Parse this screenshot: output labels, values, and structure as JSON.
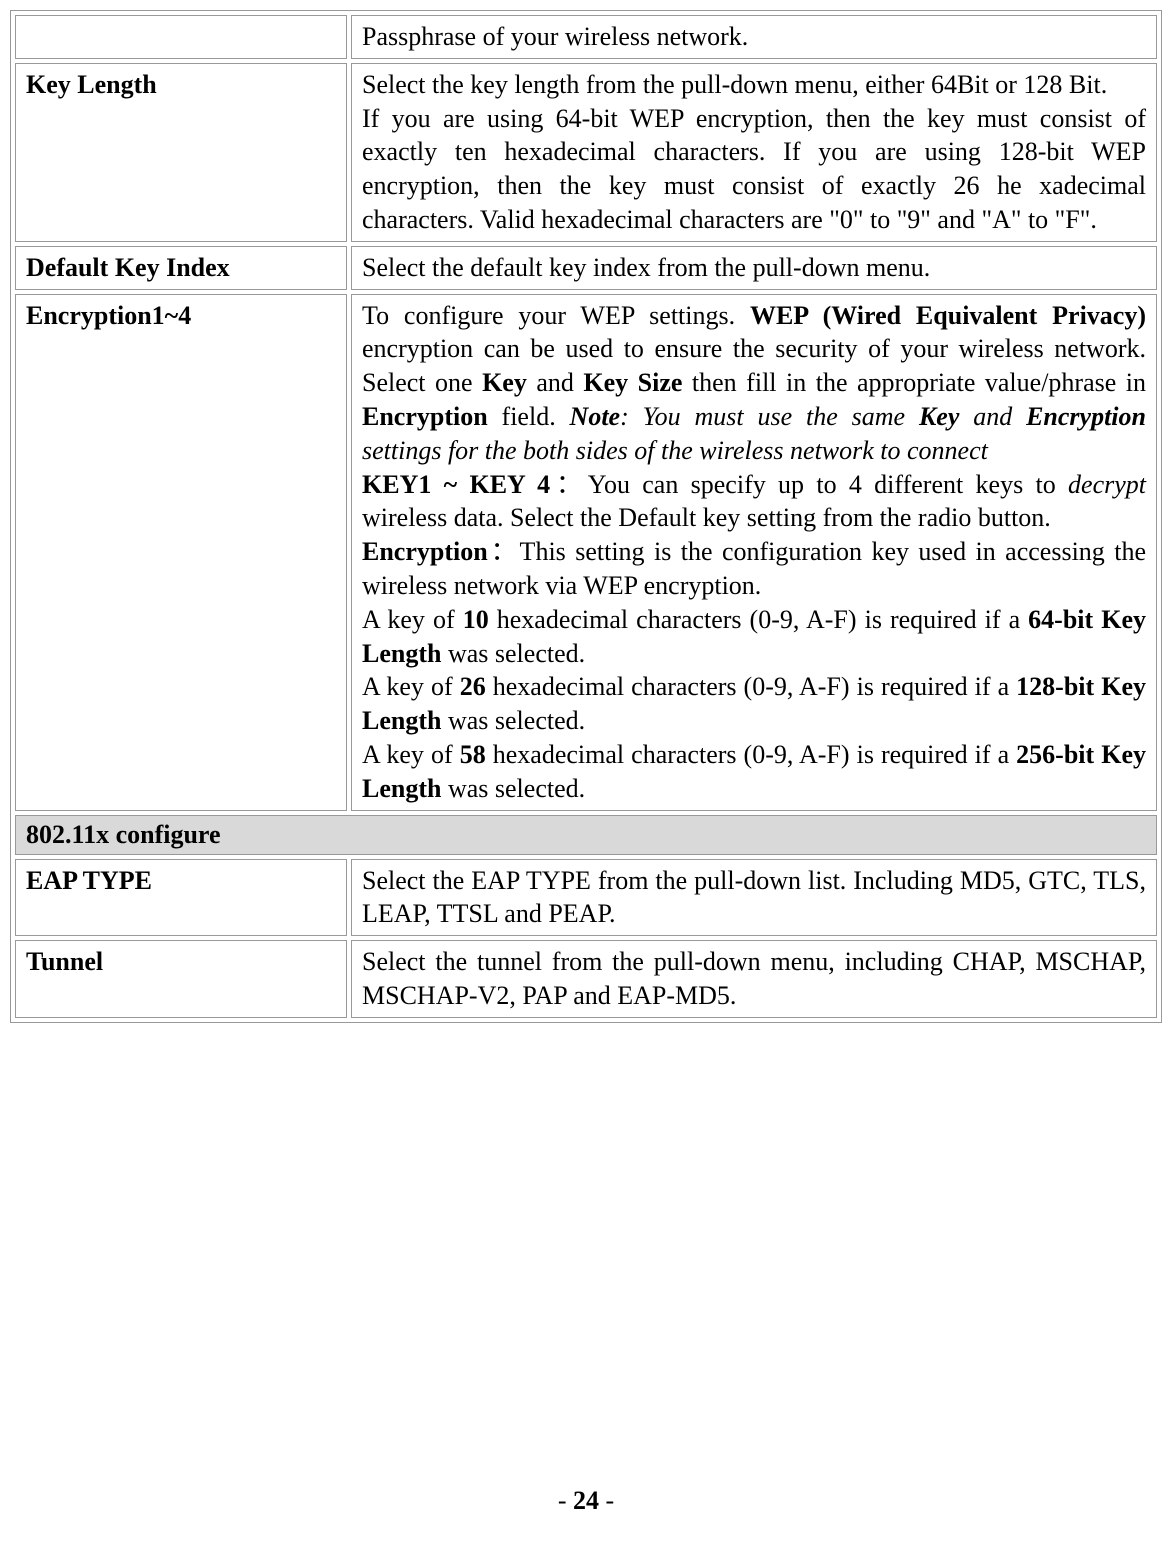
{
  "row_passphrase": {
    "label": "",
    "desc": "Passphrase of your wireless network."
  },
  "row_keylength": {
    "label": "Key Length",
    "desc": "Select the key length from the pull-down menu, either 64Bit or 128 Bit.\nIf you are using 64-bit WEP encryption, then the key must consist of exactly ten hexadecimal characters. If you are using 128-bit WEP encryption, then the key must consist of exactly 26 he xadecimal characters. Valid hexadecimal characters are \"0\" to \"9\" and \"A\" to \"F\"."
  },
  "row_defaultkey": {
    "label": "Default Key Index",
    "desc": "Select the default key index from the pull-down menu."
  },
  "row_encryption": {
    "label": "Encryption1~4",
    "t1a": "To configure your WEP settings. ",
    "t1b": "WEP (Wired Equivalent Privacy)",
    "t1c": " encryption can be used to ensure the security of your wireless network. Select one ",
    "t1d": "Key",
    "t1e": " and ",
    "t1f": "Key Size",
    "t1g": " then fill in the appropriate value/phrase in ",
    "t1h": "Encryption",
    "t1i": " field. ",
    "t1j": "Note",
    "t1k": ": You must use the same ",
    "t1l": "Key",
    "t1m": " and ",
    "t1n": "Encryption",
    "t1o": " settings for the both sides of the wireless network to connect",
    "t2a": "KEY1 ~ KEY 4",
    "t2b": "：You can specify up to 4 different keys to ",
    "t2c": "decrypt",
    "t2d": " wireless data. Select the Default key setting from the radio button.",
    "t3a": "Encryption",
    "t3b": "：This setting is the configuration key used in accessing the wireless network via WEP encryption.",
    "t4a": "A key of ",
    "t4b": "10",
    "t4c": " hexadecimal characters (0-9, A-F) is required if a ",
    "t4d": "64-bit Key Length",
    "t4e": " was selected.",
    "t5a": "A key of ",
    "t5b": "26",
    "t5c": " hexadecimal characters (0-9, A-F) is required if a ",
    "t5d": "128-bit Key Length",
    "t5e": " was selected.",
    "t6a": "A key of ",
    "t6b": "58",
    "t6c": " hexadecimal characters (0-9, A-F) is required if a ",
    "t6d": "256-bit Key Length",
    "t6e": " was selected."
  },
  "section_header": "802.11x configure",
  "row_eaptype": {
    "label": "EAP TYPE",
    "desc": "Select the EAP TYPE from the pull-down list. Including MD5, GTC, TLS, LEAP, TTSL and PEAP."
  },
  "row_tunnel": {
    "label": "Tunnel",
    "desc": "Select the tunnel from the pull-down menu, including CHAP, MSCHAP, MSCHAP-V2, PAP and EAP-MD5."
  },
  "page_number": "- 24 -"
}
